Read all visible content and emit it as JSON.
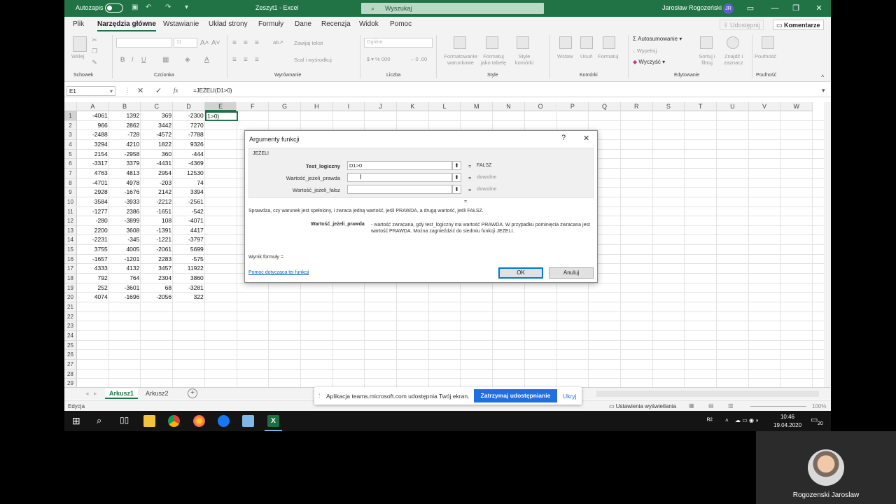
{
  "titlebar": {
    "autosave": "Autozapis",
    "doc_title": "Zeszyt1 - Excel",
    "search_placeholder": "Wyszukaj",
    "user": "Jarosław Rogozeński",
    "initials": "JR"
  },
  "menu": {
    "tabs": [
      "Plik",
      "Narzędzia główne",
      "Wstawianie",
      "Układ strony",
      "Formuły",
      "Dane",
      "Recenzja",
      "Widok",
      "Pomoc"
    ],
    "share": "Udostępnij",
    "comments": "Komentarze"
  },
  "ribbon": {
    "groups": [
      "Schowek",
      "Czcionka",
      "Wyrównanie",
      "Liczba",
      "Style",
      "Komórki",
      "Edytowanie",
      "Poufność"
    ],
    "paste": "Wklej",
    "font_size": "11",
    "wrap_text": "Zawijaj tekst",
    "merge": "Scal i wyśrodkuj",
    "number_format": "Ogólne",
    "cond_format": "Formatowanie warunkowe",
    "format_table": "Formatuj jako tabelę",
    "cell_styles": "Style komórki",
    "insert": "Wstaw",
    "delete": "Usuń",
    "format": "Formatuj",
    "autosum": "Autosumowanie",
    "fill": "Wypełnij",
    "clear": "Wyczyść",
    "sort": "Sortuj i filtruj",
    "find": "Znajdź i zaznacz",
    "sensitivity": "Poufność"
  },
  "formula_bar": {
    "name_box": "E1",
    "fx": "fx",
    "formula": "=JEŻELI(D1>0)"
  },
  "sheet": {
    "columns": [
      "A",
      "B",
      "C",
      "D",
      "E",
      "F",
      "G",
      "H",
      "I",
      "J",
      "K",
      "L",
      "M",
      "N",
      "O",
      "P",
      "Q",
      "R",
      "S",
      "T",
      "U",
      "V",
      "W"
    ],
    "active_cell_text": "1>0)",
    "rows": [
      [
        "-4061",
        "1392",
        "369",
        "-2300"
      ],
      [
        "966",
        "2862",
        "3442",
        "7270"
      ],
      [
        "-2488",
        "-728",
        "-4572",
        "-7788"
      ],
      [
        "3294",
        "4210",
        "1822",
        "9326"
      ],
      [
        "2154",
        "-2958",
        "360",
        "-444"
      ],
      [
        "-3317",
        "3379",
        "-4431",
        "-4369"
      ],
      [
        "4763",
        "4813",
        "2954",
        "12530"
      ],
      [
        "-4701",
        "4978",
        "-203",
        "74"
      ],
      [
        "2928",
        "-1676",
        "2142",
        "3394"
      ],
      [
        "3584",
        "-3933",
        "-2212",
        "-2561"
      ],
      [
        "-1277",
        "2386",
        "-1651",
        "-542"
      ],
      [
        "-280",
        "-3899",
        "108",
        "-4071"
      ],
      [
        "2200",
        "3608",
        "-1391",
        "4417"
      ],
      [
        "-2231",
        "-345",
        "-1221",
        "-3797"
      ],
      [
        "3755",
        "4005",
        "-2061",
        "5699"
      ],
      [
        "-1657",
        "-1201",
        "2283",
        "-575"
      ],
      [
        "4333",
        "4132",
        "3457",
        "11922"
      ],
      [
        "792",
        "764",
        "2304",
        "3860"
      ],
      [
        "252",
        "-3601",
        "68",
        "-3281"
      ],
      [
        "4074",
        "-1696",
        "-2056",
        "322"
      ]
    ],
    "row_numbers": [
      "1",
      "2",
      "3",
      "4",
      "5",
      "6",
      "7",
      "8",
      "9",
      "10",
      "11",
      "12",
      "13",
      "14",
      "15",
      "16",
      "17",
      "18",
      "19",
      "20",
      "21",
      "22",
      "23",
      "24",
      "25",
      "26",
      "27",
      "28",
      "29"
    ],
    "tabs": [
      "Arkusz1",
      "Arkusz2"
    ]
  },
  "status": {
    "mode": "Edycja",
    "display_settings": "Ustawienia wyświetlania",
    "zoom": "100%"
  },
  "share_banner": {
    "message": "Aplikacja teams.microsoft.com udostępnia Twój ekran.",
    "stop": "Zatrzymaj udostępnianie",
    "hide": "Ukryj"
  },
  "dialog": {
    "title": "Argumenty funkcji",
    "help_icon": "?",
    "close_icon": "✕",
    "function_name": "JEŻELI",
    "args": [
      {
        "label": "Test_logiczny",
        "value": "D1>0",
        "result": "FAŁSZ",
        "bold": true
      },
      {
        "label": "Wartość_jeżeli_prawda",
        "value": "",
        "result": "dowolne",
        "bold": false
      },
      {
        "label": "Wartość_jeżeli_fałsz",
        "value": "",
        "result": "dowolne",
        "bold": false
      }
    ],
    "eq": "=",
    "description": "Sprawdza, czy warunek jest spełniony, i zwraca jedną wartość, jeśli PRAWDA, a drugą wartość, jeśli FAŁSZ.",
    "arg_help_name": "Wartość_jeżeli_prawda",
    "arg_help_text": "- wartość zwracana, gdy test_logiczny ma wartość PRAWDA. W przypadku pominięcia zwracana jest wartość PRAWDA. Można zagnieździć do siedmiu funkcji JEŻELI.",
    "formula_result": "Wynik formuły =",
    "help_link": "Pomoc dotycząca tej funkcji",
    "ok": "OK",
    "cancel": "Anuluj"
  },
  "taskbar": {
    "time": "10:46",
    "date": "19.04.2020",
    "notif_count": "20"
  },
  "video": {
    "name": "Rogozenski Jaroslaw"
  }
}
